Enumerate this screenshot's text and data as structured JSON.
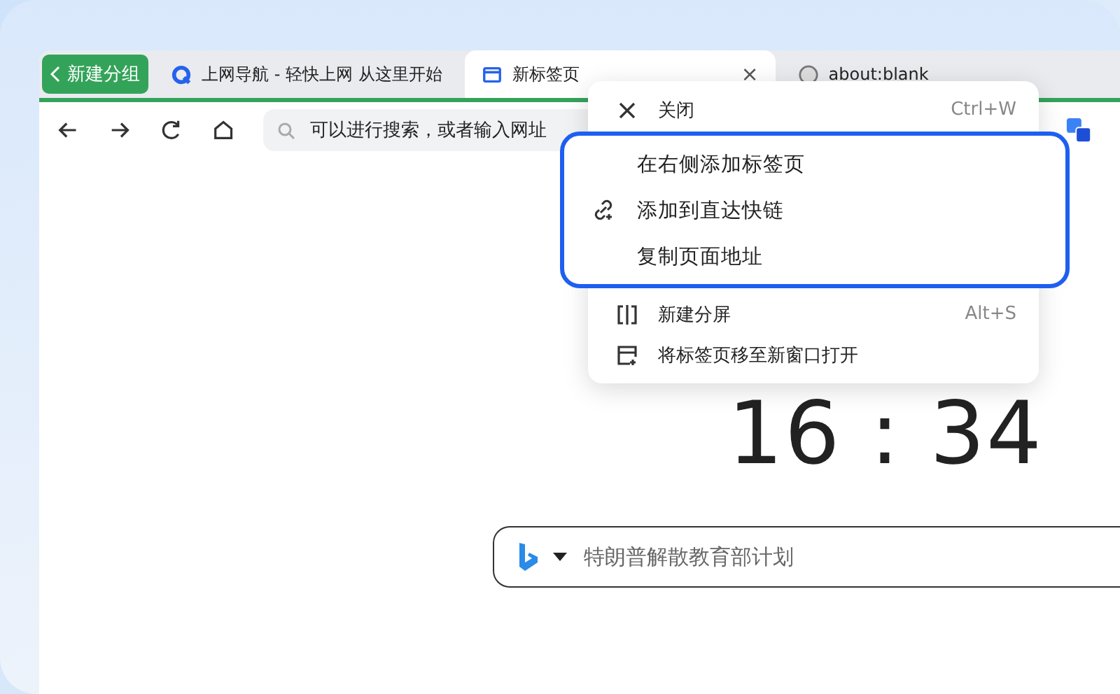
{
  "group_button": {
    "label": "新建分组"
  },
  "tabs": [
    {
      "label": "上网导航 - 轻快上网 从这里开始",
      "kind": "nav",
      "selected": false
    },
    {
      "label": "新标签页",
      "kind": "page",
      "selected": true,
      "close": "×"
    },
    {
      "label": "about:blank",
      "kind": "globe",
      "selected": false
    }
  ],
  "address_bar": {
    "placeholder": "可以进行搜索，或者输入网址"
  },
  "context_menu": {
    "items": [
      {
        "kind": "close",
        "label": "关闭",
        "shortcut": "Ctrl+W"
      },
      {
        "kind": "split",
        "label": "新建分屏",
        "shortcut": "Alt+S"
      },
      {
        "kind": "move",
        "label": "将标签页移至新窗口打开"
      }
    ]
  },
  "highlight_box": {
    "items": [
      {
        "kind": "plain",
        "label": "在右侧添加标签页"
      },
      {
        "kind": "link",
        "label": "添加到直达快链"
      },
      {
        "kind": "plain",
        "label": "复制页面地址"
      }
    ]
  },
  "clock": "16 : 34",
  "search": {
    "placeholder": "特朗普解散教育部计划"
  }
}
